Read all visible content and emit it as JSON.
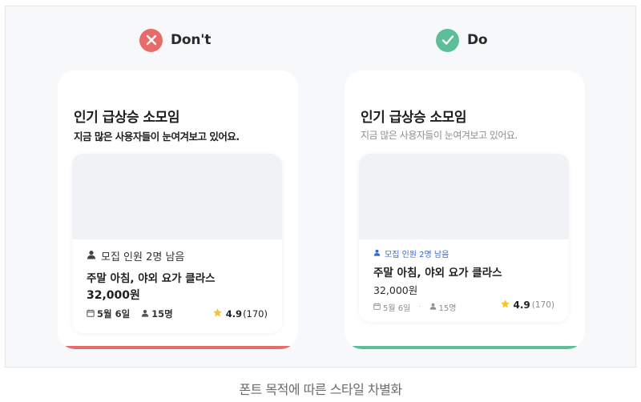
{
  "dont": {
    "verdict_label": "Don't",
    "card": {
      "title": "인기 급상승 소모임",
      "subtitle": "지금 많은 사용자들이 눈여겨보고 있어요.",
      "recruit_text": "모집 인원 2명 남음",
      "class_name": "주말 아침, 야외 요가 클라스",
      "price": "32,000원",
      "date": "5월 6일",
      "attendees": "15명",
      "rating": "4.9",
      "review_count": "(170)"
    },
    "accent_color": "#e86b6b"
  },
  "do": {
    "verdict_label": "Do",
    "card": {
      "title": "인기 급상승 소모임",
      "subtitle": "지금 많은 사용자들이 눈여겨보고 있어요.",
      "recruit_text": "모집 인원 2명 남음",
      "class_name": "주말 아침, 야외 요가 클라스",
      "price": "32,000원",
      "date": "5월 6일",
      "attendees": "15명",
      "rating": "4.9",
      "review_count": "(170)"
    },
    "accent_color": "#5dbf9a"
  },
  "caption": "폰트 목적에 따른 스타일 차별화",
  "icons": {
    "dont_badge": "close-icon",
    "do_badge": "check-icon",
    "recruit": "person-icon",
    "date": "calendar-icon",
    "attendees": "person-icon",
    "rating": "star-icon"
  },
  "colors": {
    "star": "#f4c430",
    "recruit_do": "#3767d0"
  }
}
